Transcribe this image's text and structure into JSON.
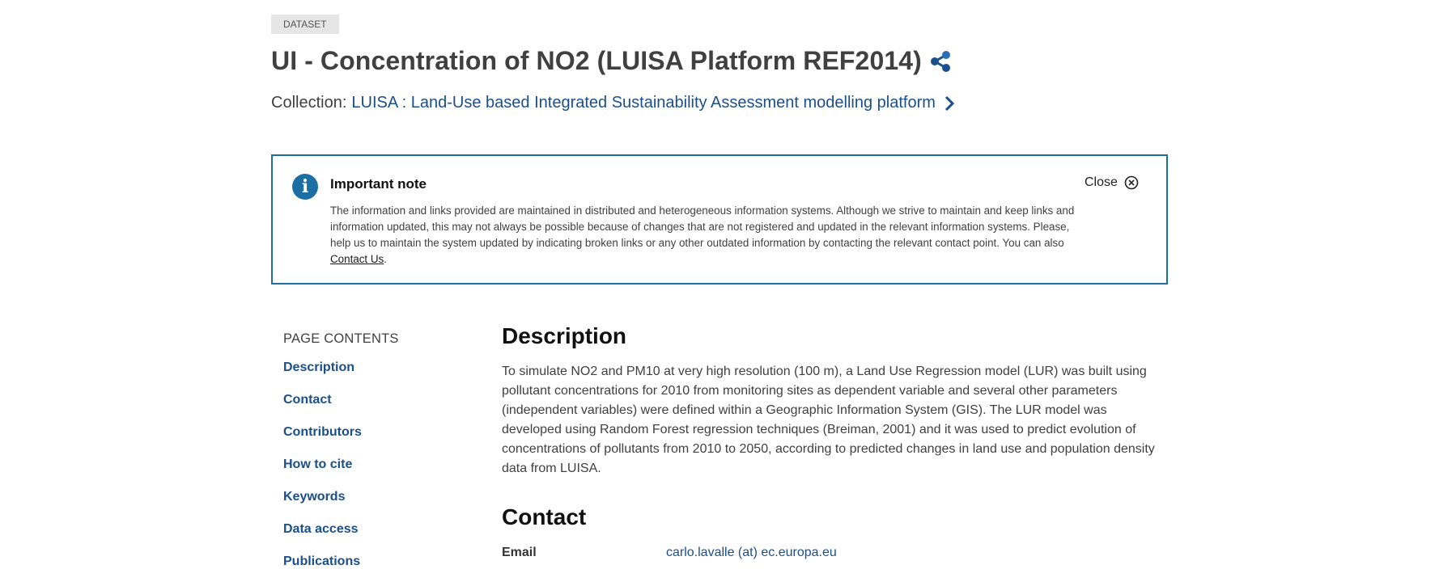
{
  "badge": "DATASET",
  "title": "UI - Concentration of NO2 (LUISA Platform REF2014)",
  "collection": {
    "prefix": "Collection:",
    "link": "LUISA : Land-Use based Integrated Sustainability Assessment modelling platform"
  },
  "note": {
    "title": "Important note",
    "text": "The information and links provided are maintained in distributed and heterogeneous information systems. Although we strive to maintain and keep links and information updated, this may not always be possible because of changes that are not registered and updated in the relevant information systems. Please, help us to maintain the system updated by indicating broken links or any other outdated information by contacting the relevant contact point. You can also ",
    "link": "Contact Us",
    "text_end": ".",
    "close": "Close"
  },
  "toc": {
    "heading": "PAGE CONTENTS",
    "items": [
      "Description",
      "Contact",
      "Contributors",
      "How to cite",
      "Keywords",
      "Data access",
      "Publications"
    ]
  },
  "description": {
    "heading": "Description",
    "text": "To simulate NO2 and PM10 at very high resolution (100 m), a Land Use Regression model (LUR) was built using pollutant concentrations for 2010 from monitoring sites as dependent variable and several other parameters (independent variables) were defined within a Geographic Information System (GIS). The LUR model was developed using Random Forest regression techniques (Breiman, 2001) and it was used to predict evolution of concentrations of pollutants from 2010 to 2050, according to predicted changes in land use and population density data from LUISA."
  },
  "contact": {
    "heading": "Contact",
    "email_label": "Email",
    "email_value": "carlo.lavalle (at) ec.europa.eu"
  },
  "icons": {
    "share": "share-icon",
    "chevron": "chevron-right-icon",
    "info": "info-icon",
    "close": "close-circle-icon"
  },
  "colors": {
    "link": "#1a4f8b",
    "accent": "#1b6fa5"
  }
}
